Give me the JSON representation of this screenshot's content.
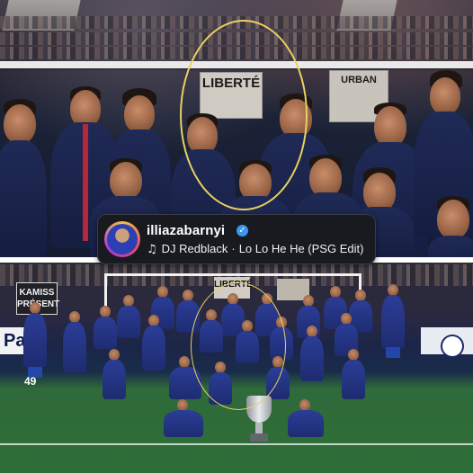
{
  "story": {
    "music_sticker": {
      "username": "illiazabarnyi",
      "verified_glyph": "✓",
      "music_icon": "music-note-icon",
      "music_glyph": "♫",
      "artist": "DJ Redblack",
      "separator": "·",
      "song_title": "Lo Lo He He (PSG Edit)"
    },
    "top_photo": {
      "banner_text": "LIBERTÉ",
      "banner2_text": "URBAN"
    },
    "bottom_photo": {
      "sign_text": "KAMISS PRÉSENT",
      "banner_text": "LIBERTÉ",
      "ad_board_text": "Pari",
      "jersey_number": "49"
    },
    "colors": {
      "highlight_ellipse": "#e8d160",
      "sticker_bg": "#181a20",
      "verified_badge": "#3897f0",
      "kit_navy": "#1f2a56",
      "kit_blue": "#2b3d97"
    }
  }
}
